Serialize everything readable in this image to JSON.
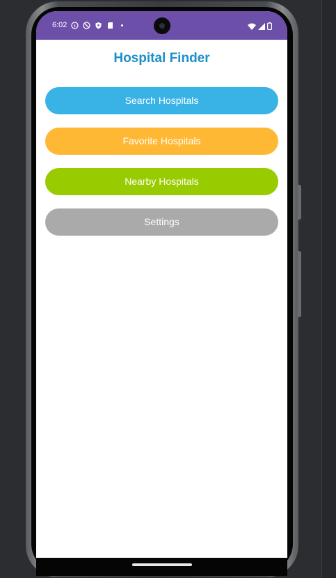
{
  "status_bar": {
    "time": "6:02",
    "background": "#6c4fa8",
    "left_icons": [
      "info-icon",
      "blocked-icon",
      "shield-icon",
      "sd-card-icon",
      "dot-icon"
    ],
    "right_icons": [
      "wifi-icon",
      "signal-icon",
      "battery-icon"
    ]
  },
  "app": {
    "title": "Hospital Finder",
    "title_color": "#1c8fc8"
  },
  "menu": {
    "search": {
      "label": "Search Hospitals",
      "color": "#39b3e6"
    },
    "favorites": {
      "label": "Favorite Hospitals",
      "color": "#ffb833"
    },
    "nearby": {
      "label": "Nearby Hospitals",
      "color": "#99cc00"
    },
    "settings": {
      "label": "Settings",
      "color": "#aaaaaa"
    }
  }
}
